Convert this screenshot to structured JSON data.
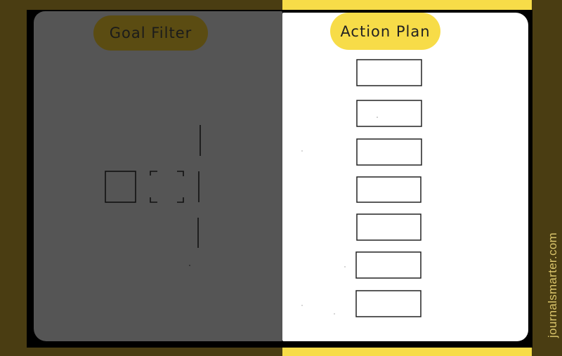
{
  "left_page": {
    "title": "Goal Filter"
  },
  "right_page": {
    "title": "Action Plan",
    "action_box_count": 7
  },
  "watermark": "journalsmarter.com",
  "colors": {
    "background": "#4a3d12",
    "accent_yellow": "#f7dc48",
    "left_pill": "#5b4c12",
    "left_page": "#555555",
    "right_page": "#ffffff"
  }
}
